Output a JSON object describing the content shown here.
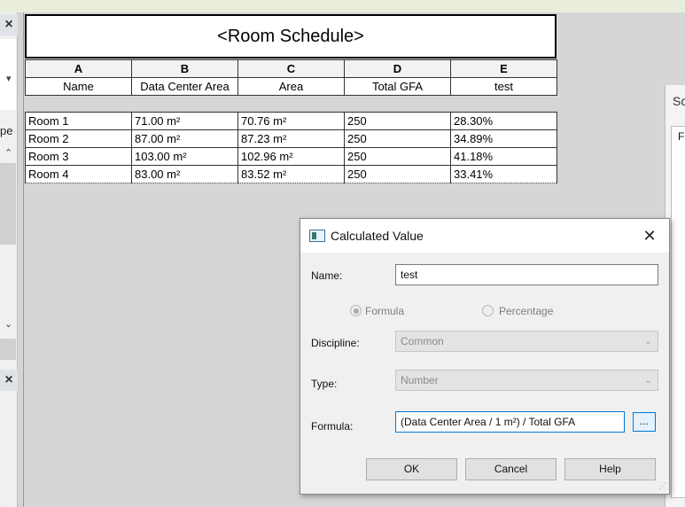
{
  "left_panel": {
    "close_label": "×",
    "partial_text": "pe",
    "close_label_2": "×"
  },
  "schedule": {
    "title": "<Room Schedule>",
    "column_letters": [
      "A",
      "B",
      "C",
      "D",
      "E"
    ],
    "column_headers": [
      "Name",
      "Data Center Area",
      "Area",
      "Total GFA",
      "test"
    ],
    "rows": [
      [
        "Room 1",
        "71.00 m²",
        "70.76 m²",
        "250",
        "28.30%"
      ],
      [
        "Room 2",
        "87.00 m²",
        "87.23 m²",
        "250",
        "34.89%"
      ],
      [
        "Room 3",
        "103.00 m²",
        "102.96 m²",
        "250",
        "41.18%"
      ],
      [
        "Room 4",
        "83.00 m²",
        "83.52 m²",
        "250",
        "33.41%"
      ]
    ]
  },
  "right_panel": {
    "partial_title": "Sc",
    "partial_text": "F"
  },
  "dialog": {
    "title": "Calculated Value",
    "close_label": "✕",
    "name_label": "Name:",
    "name_value": "test",
    "radio_formula": "Formula",
    "radio_percentage": "Percentage",
    "discipline_label": "Discipline:",
    "discipline_value": "Common",
    "type_label": "Type:",
    "type_value": "Number",
    "formula_label": "Formula:",
    "formula_value": "(Data Center Area / 1 m²) / Total GFA",
    "ellipsis_label": "...",
    "ok_label": "OK",
    "cancel_label": "Cancel",
    "help_label": "Help"
  }
}
